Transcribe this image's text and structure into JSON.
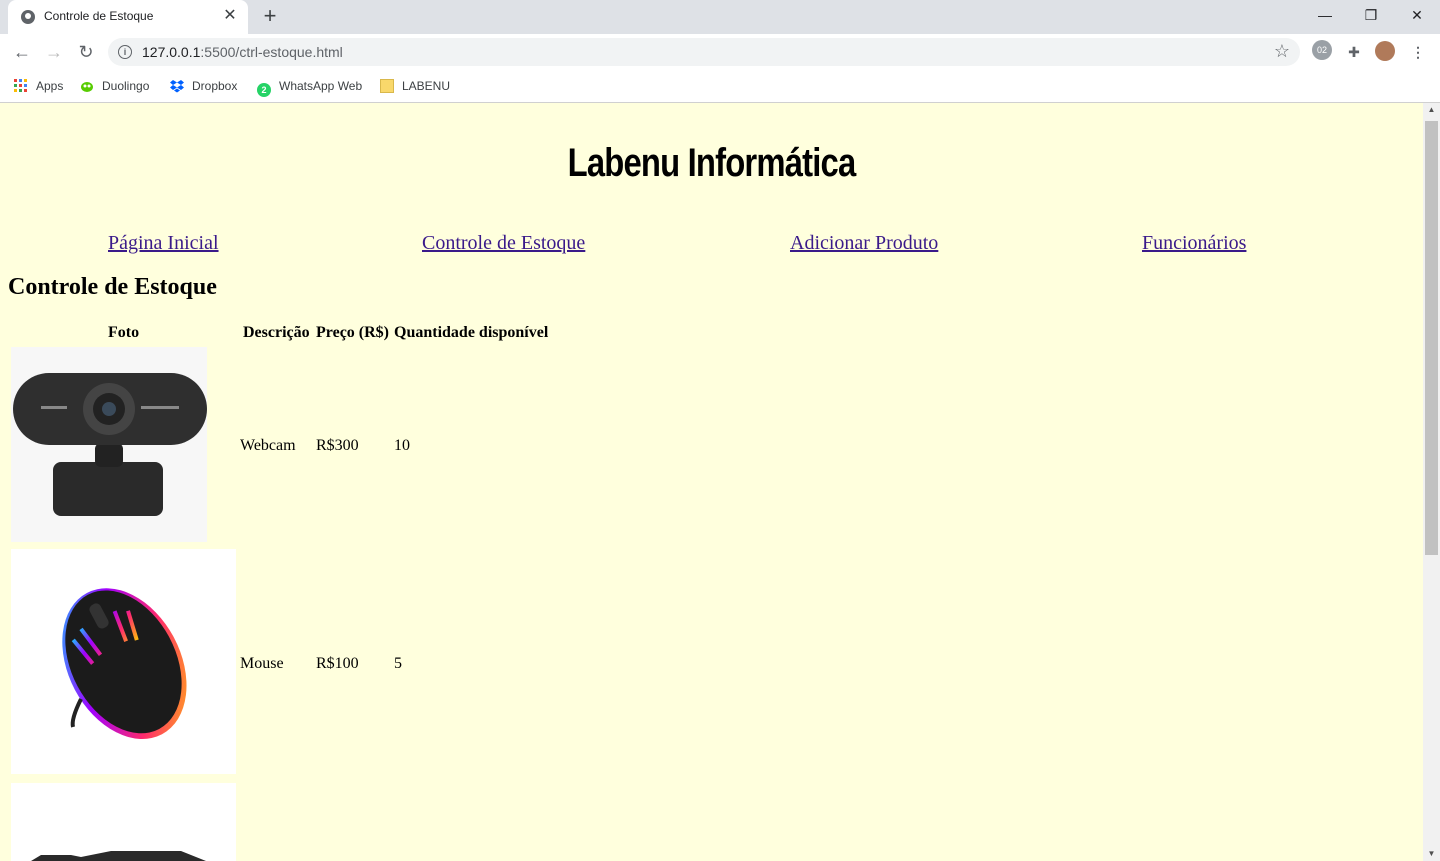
{
  "browser": {
    "tab_title": "Controle de Estoque",
    "tab_close": "✕",
    "new_tab": "+",
    "window_controls": {
      "minimize": "—",
      "restore": "❐",
      "close": "✕"
    },
    "url_host": "127.0.0.1",
    "url_rest": ":5500/ctrl-estoque.html",
    "bookmarks": [
      "Apps",
      "Duolingo",
      "Dropbox",
      "WhatsApp Web",
      "LABENU"
    ],
    "whatsapp_badge": "2"
  },
  "page": {
    "site_title": "Labenu Informática",
    "nav": [
      "Página Inicial",
      "Controle de Estoque",
      "Adicionar Produto",
      "Funcionários"
    ],
    "section_title": "Controle de Estoque",
    "table": {
      "headers": [
        "Foto",
        "Descrição",
        "Preço (R$)",
        "Quantidade disponível"
      ],
      "rows": [
        {
          "photo": "webcam-image",
          "description": "Webcam",
          "price": "R$300",
          "quantity": "10"
        },
        {
          "photo": "mouse-image",
          "description": "Mouse",
          "price": "R$100",
          "quantity": "5"
        },
        {
          "photo": "keyboard-image"
        }
      ]
    }
  },
  "colors": {
    "page_background": "#ffffdd",
    "link": "#3a1a8a"
  }
}
